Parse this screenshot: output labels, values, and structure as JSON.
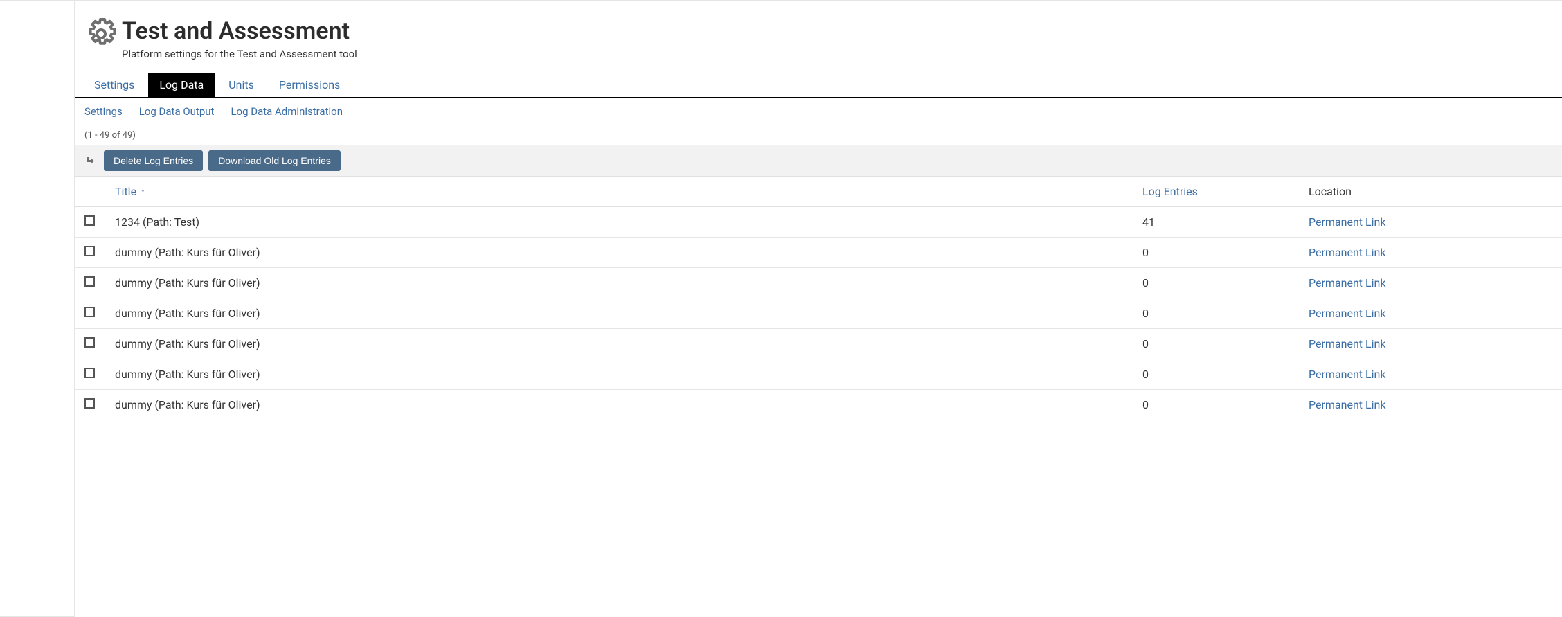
{
  "header": {
    "title": "Test and Assessment",
    "subtitle": "Platform settings for the Test and Assessment tool"
  },
  "tabs": [
    {
      "label": "Settings",
      "active": false
    },
    {
      "label": "Log Data",
      "active": true
    },
    {
      "label": "Units",
      "active": false
    },
    {
      "label": "Permissions",
      "active": false
    }
  ],
  "subtabs": [
    {
      "label": "Settings",
      "active": false
    },
    {
      "label": "Log Data Output",
      "active": false
    },
    {
      "label": "Log Data Administration",
      "active": true
    }
  ],
  "count_info": "(1 - 49 of 49)",
  "toolbar": {
    "delete_label": "Delete Log Entries",
    "download_label": "Download Old Log Entries"
  },
  "columns": {
    "title": "Title",
    "log_entries": "Log Entries",
    "location": "Location"
  },
  "rows": [
    {
      "title": "1234 (Path: Test)",
      "log_entries": "41",
      "location": "Permanent Link"
    },
    {
      "title": "dummy (Path: Kurs für Oliver)",
      "log_entries": "0",
      "location": "Permanent Link"
    },
    {
      "title": "dummy (Path: Kurs für Oliver)",
      "log_entries": "0",
      "location": "Permanent Link"
    },
    {
      "title": "dummy (Path: Kurs für Oliver)",
      "log_entries": "0",
      "location": "Permanent Link"
    },
    {
      "title": "dummy (Path: Kurs für Oliver)",
      "log_entries": "0",
      "location": "Permanent Link"
    },
    {
      "title": "dummy (Path: Kurs für Oliver)",
      "log_entries": "0",
      "location": "Permanent Link"
    },
    {
      "title": "dummy (Path: Kurs für Oliver)",
      "log_entries": "0",
      "location": "Permanent Link"
    }
  ]
}
